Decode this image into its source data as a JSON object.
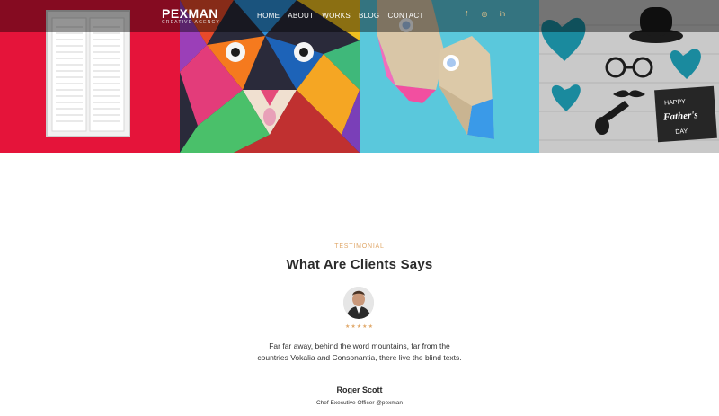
{
  "brand": {
    "name": "PEXMAN",
    "tagline": "CREATIVE AGENCY"
  },
  "nav": {
    "items": [
      {
        "label": "HOME"
      },
      {
        "label": "ABOUT"
      },
      {
        "label": "WORKS"
      },
      {
        "label": "BLOG"
      },
      {
        "label": "CONTACT"
      }
    ]
  },
  "social": [
    {
      "icon": "facebook-icon",
      "glyph": "f"
    },
    {
      "icon": "instagram-icon",
      "glyph": "◎"
    },
    {
      "icon": "linkedin-icon",
      "glyph": "in"
    }
  ],
  "gallery": [
    {
      "subject": "white-shutter-window-red-wall"
    },
    {
      "subject": "colorful-geometric-lion-mural"
    },
    {
      "subject": "paper-birds-on-blue"
    },
    {
      "subject": "happy-fathers-day-props"
    }
  ],
  "fathers_day_sign": {
    "line1": "HAPPY",
    "line2": "Father's",
    "line3": "DAY"
  },
  "testimonial": {
    "kicker": "TESTIMONIAL",
    "title": "What Are Clients Says",
    "stars": "★★★★★",
    "quote_line1": "Far far away, behind the word mountains, far from the",
    "quote_line2": "countries Vokalia and Consonantia, there live the blind texts.",
    "name": "Roger Scott",
    "role": "Chef Executive Officer @pexman"
  },
  "colors": {
    "accent": "#e0a86a",
    "nav_overlay": "rgba(0,0,0,0.42)",
    "red_wall": "#e5143a",
    "teal": "#5ac8dc"
  }
}
